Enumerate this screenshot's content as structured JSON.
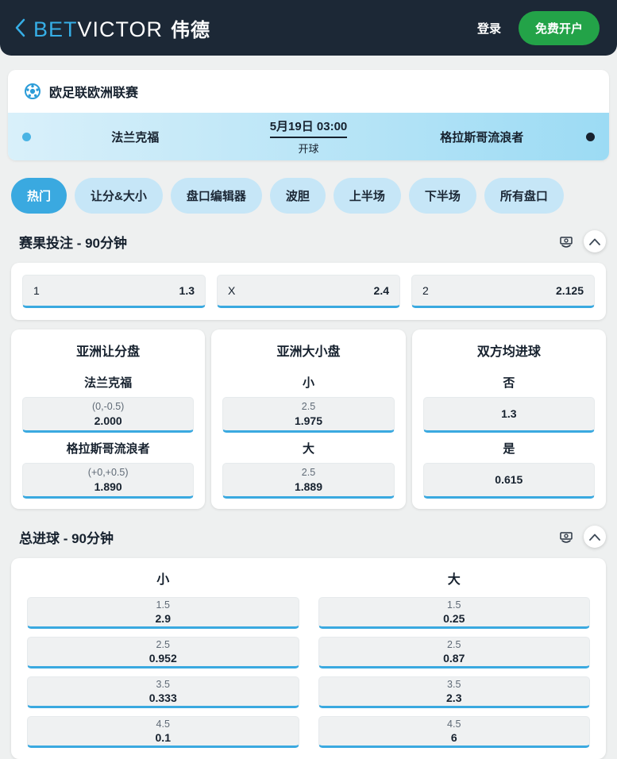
{
  "header": {
    "logo_bet": "BET",
    "logo_victor": "VICTOR",
    "logo_cn": "伟德",
    "login_label": "登录",
    "signup_label": "免费开户"
  },
  "league": {
    "name": "欧足联欧洲联赛"
  },
  "match": {
    "home": "法兰克福",
    "away": "格拉斯哥流浪者",
    "datetime": "5月19日 03:00",
    "status": "开球"
  },
  "tabs": [
    {
      "label": "热门",
      "active": true
    },
    {
      "label": "让分&大小",
      "active": false
    },
    {
      "label": "盘口编辑器",
      "active": false
    },
    {
      "label": "波胆",
      "active": false
    },
    {
      "label": "上半场",
      "active": false
    },
    {
      "label": "下半场",
      "active": false
    },
    {
      "label": "所有盘口",
      "active": false
    }
  ],
  "sections": [
    {
      "title": "赛果投注 - 90分钟"
    },
    {
      "title": "总进球 - 90分钟"
    }
  ],
  "match_result": {
    "selections": [
      {
        "label": "1",
        "odds": "1.3"
      },
      {
        "label": "X",
        "odds": "2.4"
      },
      {
        "label": "2",
        "odds": "2.125"
      }
    ]
  },
  "panels": [
    {
      "title": "亚洲让分盘",
      "selections": [
        {
          "label": "法兰克福",
          "line": "(0,-0.5)",
          "odds": "2.000"
        },
        {
          "label": "格拉斯哥流浪者",
          "line": "(+0,+0.5)",
          "odds": "1.890"
        }
      ]
    },
    {
      "title": "亚洲大小盘",
      "selections": [
        {
          "label": "小",
          "line": "2.5",
          "odds": "1.975"
        },
        {
          "label": "大",
          "line": "2.5",
          "odds": "1.889"
        }
      ]
    },
    {
      "title": "双方均进球",
      "selections": [
        {
          "label": "否",
          "line": "",
          "odds": "1.3"
        },
        {
          "label": "是",
          "line": "",
          "odds": "0.615"
        }
      ]
    }
  ],
  "totals": {
    "columns": [
      {
        "header": "小",
        "rows": [
          {
            "line": "1.5",
            "odds": "2.9"
          },
          {
            "line": "2.5",
            "odds": "0.952"
          },
          {
            "line": "3.5",
            "odds": "0.333"
          },
          {
            "line": "4.5",
            "odds": "0.1"
          }
        ]
      },
      {
        "header": "大",
        "rows": [
          {
            "line": "1.5",
            "odds": "0.25"
          },
          {
            "line": "2.5",
            "odds": "0.87"
          },
          {
            "line": "3.5",
            "odds": "2.3"
          },
          {
            "line": "4.5",
            "odds": "6"
          }
        ]
      }
    ]
  },
  "colors": {
    "header_bg": "#1c2836",
    "accent_blue": "#3aa9e0",
    "logo_blue": "#36aee6",
    "signup_green": "#23a348",
    "tab_inactive": "#c6e6f7",
    "match_row_gradient_start": "#d9f0fa",
    "match_row_gradient_end": "#9cdbf4",
    "page_bg": "#eef0f0"
  }
}
